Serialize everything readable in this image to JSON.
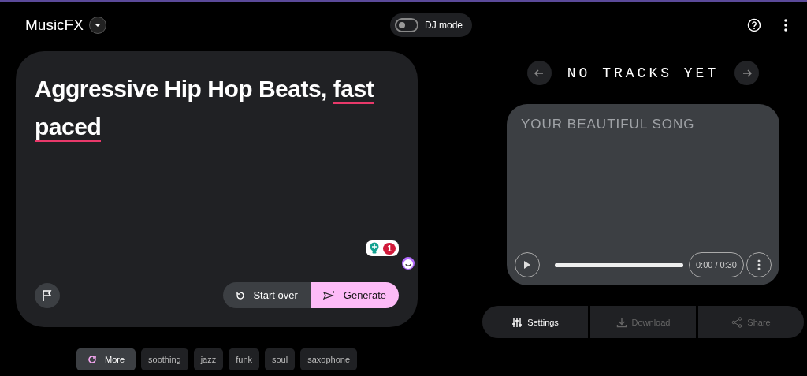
{
  "app": {
    "title": "MusicFX"
  },
  "dj_mode": {
    "label": "DJ mode",
    "on": false
  },
  "prompt": {
    "segments": [
      {
        "text": "Aggressive Hip Hop Beats,",
        "underlined": false
      },
      {
        "text": "fast",
        "underlined": true
      },
      {
        "text": "paced",
        "underlined": true
      }
    ]
  },
  "extension_badge": {
    "count": "1"
  },
  "prompt_actions": [
    {
      "label": "Start over",
      "kind": "reset"
    },
    {
      "label": "Generate",
      "kind": "generate"
    }
  ],
  "chips": [
    {
      "label": "More",
      "kind": "more"
    },
    {
      "label": "soothing",
      "kind": "tag"
    },
    {
      "label": "jazz",
      "kind": "tag"
    },
    {
      "label": "funk",
      "kind": "tag"
    },
    {
      "label": "soul",
      "kind": "tag"
    },
    {
      "label": "saxophone",
      "kind": "tag"
    }
  ],
  "tracks": {
    "heading": "NO TRACKS YET"
  },
  "song_card": {
    "title": "YOUR BEAUTIFUL SONG",
    "time": "0:00 / 0:30"
  },
  "track_actions": [
    {
      "label": "Settings",
      "kind": "settings",
      "disabled": false
    },
    {
      "label": "Download",
      "kind": "download",
      "disabled": true
    },
    {
      "label": "Share",
      "kind": "share",
      "disabled": true
    }
  ]
}
